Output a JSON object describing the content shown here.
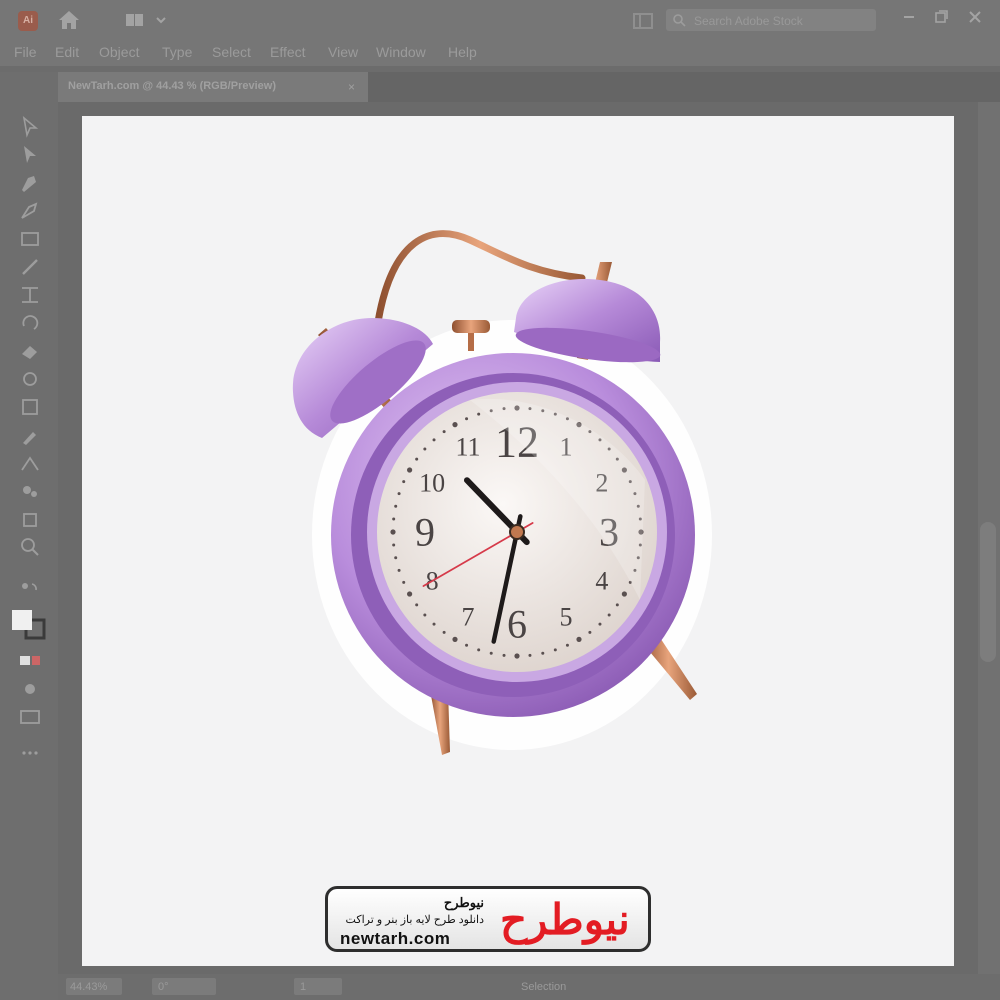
{
  "app": {
    "logo_text": "Ai"
  },
  "search": {
    "placeholder": "Search Adobe Stock"
  },
  "menu": {
    "items": [
      "File",
      "Edit",
      "Object",
      "Type",
      "Select",
      "Effect",
      "View",
      "Window",
      "Help"
    ]
  },
  "document_tab": {
    "title": "NewTarh.com @ 44.43 % (RGB/Preview)",
    "close": "×"
  },
  "clock": {
    "numerals": [
      "12",
      "1",
      "2",
      "3",
      "4",
      "5",
      "6",
      "7",
      "8",
      "9",
      "10",
      "11"
    ],
    "time": {
      "hour": 10,
      "minute": 32,
      "second": 40
    },
    "case_color": "#b58ad8",
    "metal_color": "#c1784f",
    "face_color": "#f1ece8",
    "second_hand_color": "#d63a4a"
  },
  "watermark": {
    "brand": "نیوطرح",
    "name": "نیوطرح",
    "tagline": "دانلود طرح لایه باز بنر و تراکت",
    "url": "newtarh.com"
  },
  "status": {
    "zoom": "44.43%",
    "rotation": "0°",
    "artboard": "1",
    "mode": "Selection"
  }
}
